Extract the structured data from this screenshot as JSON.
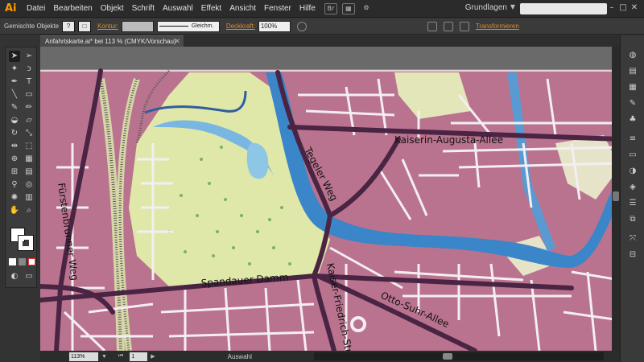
{
  "menubar": {
    "app_logo": "Ai",
    "items": [
      "Datei",
      "Bearbeiten",
      "Objekt",
      "Schrift",
      "Auswahl",
      "Effekt",
      "Ansicht",
      "Fenster",
      "Hilfe"
    ],
    "bridge_label": "Br",
    "workspace": "Grundlagen"
  },
  "controlbar": {
    "selection_label": "Gemischte Objekte",
    "stroke_link": "Kontur:",
    "stroke_style": "Gleichm.",
    "opacity_link": "Deckkraft:",
    "opacity_value": "100%",
    "transform_link": "Transformieren"
  },
  "document": {
    "tab_title": "Anfahrtskarte.ai* bei 113 % (CMYK/Vorschau)"
  },
  "map": {
    "labels": {
      "kaiserin": "Kaiserin-Augusta-Allee",
      "tegeler": "Tegeler Weg",
      "fuerstenbrunner": "Fürstenbrunner Weg",
      "spandauer": "Spandauer Damm",
      "kaiser_friedrich": "Kaiser-Friedrich-Straße",
      "otto_suhr": "Otto-Suhr-Allee"
    },
    "colors": {
      "blocks": "#b9738f",
      "streets": "#f4eef2",
      "main_roads": "#4a2443",
      "park": "#dfe8a8",
      "water": "#3a86c8",
      "water_light": "#8ec6e6"
    }
  },
  "statusbar": {
    "zoom": "113%",
    "page": "1",
    "tool_status": "Auswahl"
  }
}
